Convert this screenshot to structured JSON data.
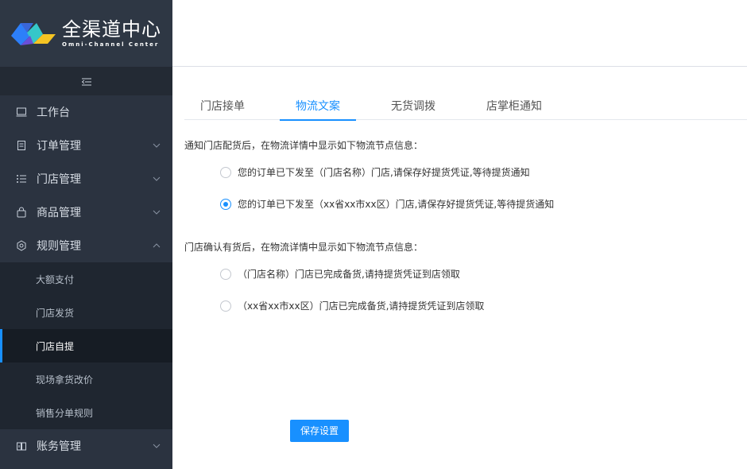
{
  "brand": {
    "title": "全渠道中心",
    "subtitle": "Omni-Channel Center",
    "colors": [
      "#2d7ff9",
      "#35c7c9",
      "#f5c423"
    ]
  },
  "sidebar": {
    "collapse_icon": "menu-fold-icon",
    "items": [
      {
        "label": "工作台",
        "icon": "monitor-icon"
      },
      {
        "label": "订单管理",
        "icon": "document-icon"
      },
      {
        "label": "门店管理",
        "icon": "list-icon"
      },
      {
        "label": "商品管理",
        "icon": "bag-icon"
      },
      {
        "label": "规则管理",
        "icon": "settings-icon"
      },
      {
        "label": "账务管理",
        "icon": "book-icon"
      }
    ],
    "rules_sub": [
      {
        "label": "大额支付"
      },
      {
        "label": "门店发货"
      },
      {
        "label": "门店自提"
      },
      {
        "label": "现场拿货改价"
      },
      {
        "label": "销售分单规则"
      }
    ],
    "active_sub": "门店自提",
    "accent": "#1890ff"
  },
  "tabs": [
    {
      "label": "门店接单"
    },
    {
      "label": "物流文案"
    },
    {
      "label": "无货调拨"
    },
    {
      "label": "店掌柜通知"
    }
  ],
  "active_tab": "物流文案",
  "section1": {
    "label": "通知门店配货后，在物流详情中显示如下物流节点信息：",
    "options": [
      {
        "text": "您的订单已下发至（门店名称）门店,请保存好提货凭证,等待提货通知",
        "checked": false
      },
      {
        "text": "您的订单已下发至（xx省xx市xx区）门店,请保存好提货凭证,等待提货通知",
        "checked": true
      }
    ]
  },
  "section2": {
    "label": "门店确认有货后，在物流详情中显示如下物流节点信息：",
    "options": [
      {
        "text": "（门店名称）门店已完成备货,请持提货凭证到店领取",
        "checked": false
      },
      {
        "text": "（xx省xx市xx区）门店已完成备货,请持提货凭证到店领取",
        "checked": false
      }
    ]
  },
  "save_label": "保存设置"
}
